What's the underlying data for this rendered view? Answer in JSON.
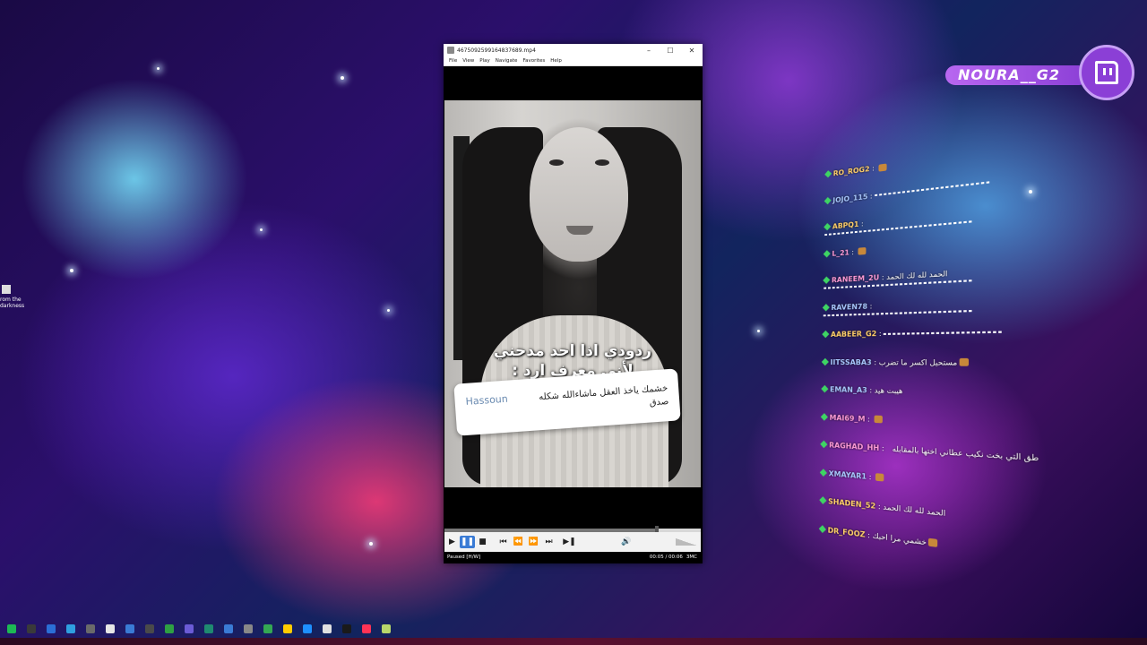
{
  "desktop": {
    "shortcut_label": "rom the darkness"
  },
  "player": {
    "title": "4675092599164837689.mp4",
    "menu": [
      "File",
      "View",
      "Play",
      "Navigate",
      "Favorites",
      "Help"
    ],
    "window_buttons": {
      "minimize": "–",
      "maximize": "☐",
      "close": "✕"
    },
    "caption_line1": "ردودي اذا احد مدحني",
    "caption_line2": "لأني معرف ارد :",
    "comment_user": "Hassoun",
    "comment_text": "خشمك ياخذ العقل ماشاءالله شكله صدق",
    "progress": 0.83,
    "status": "Paused [H/W]",
    "time": "00:05 / 00:06",
    "badge": "3MC",
    "controls": {
      "play": "▶",
      "pause": "❚❚",
      "stop": "■",
      "prev": "⏮",
      "rewind": "⏪",
      "forward": "⏩",
      "next": "⏭",
      "frame_step": "▶❚",
      "volume": "🔊"
    }
  },
  "twitch": {
    "channel": "NOURA__G2",
    "brand_color": "#9146ff"
  },
  "chat": [
    {
      "name": "RO_ROG2",
      "text": "",
      "style": "gold",
      "extra": "emote"
    },
    {
      "name": "JOJO_115",
      "text": "",
      "style": "blue",
      "extra": "wave"
    },
    {
      "name": "ABPQ1",
      "text": "",
      "style": "gold",
      "extra": "wave2"
    },
    {
      "name": "L_21",
      "text": "",
      "style": "pink",
      "extra": "emote"
    },
    {
      "name": "RANEEM_2U",
      "text": "الحمد لله لك الحمد",
      "style": "pink",
      "extra": "wave2"
    },
    {
      "name": "RAVEN78",
      "text": "",
      "style": "blue",
      "extra": "wave2"
    },
    {
      "name": "AABEER_G2",
      "text": "",
      "style": "gold",
      "extra": "wave"
    },
    {
      "name": "IITSSABA3",
      "text": "مستحيل اكسر ما تضرب",
      "style": "blue",
      "extra": "emote"
    },
    {
      "name": "EMAN_A3",
      "text": "هيبت هيد",
      "style": "blue",
      "extra": ""
    },
    {
      "name": "MAI69_M",
      "text": "",
      "style": "pink",
      "extra": "emote"
    },
    {
      "name": "RAGHAD_HH",
      "text": "",
      "style": "pink",
      "extra": "row2",
      "row2": "طق التي بخت نكيب عطاني اختها بالمقابله"
    },
    {
      "name": "XMAYAR1",
      "text": "",
      "style": "blue",
      "extra": "emote"
    },
    {
      "name": "SHADEN_52",
      "text": "الحمد لله لك الحمد",
      "style": "gold",
      "extra": ""
    },
    {
      "name": "DR_FOOZ",
      "text": "خشمي مرا احبك",
      "style": "gold",
      "extra": "emote"
    }
  ]
}
